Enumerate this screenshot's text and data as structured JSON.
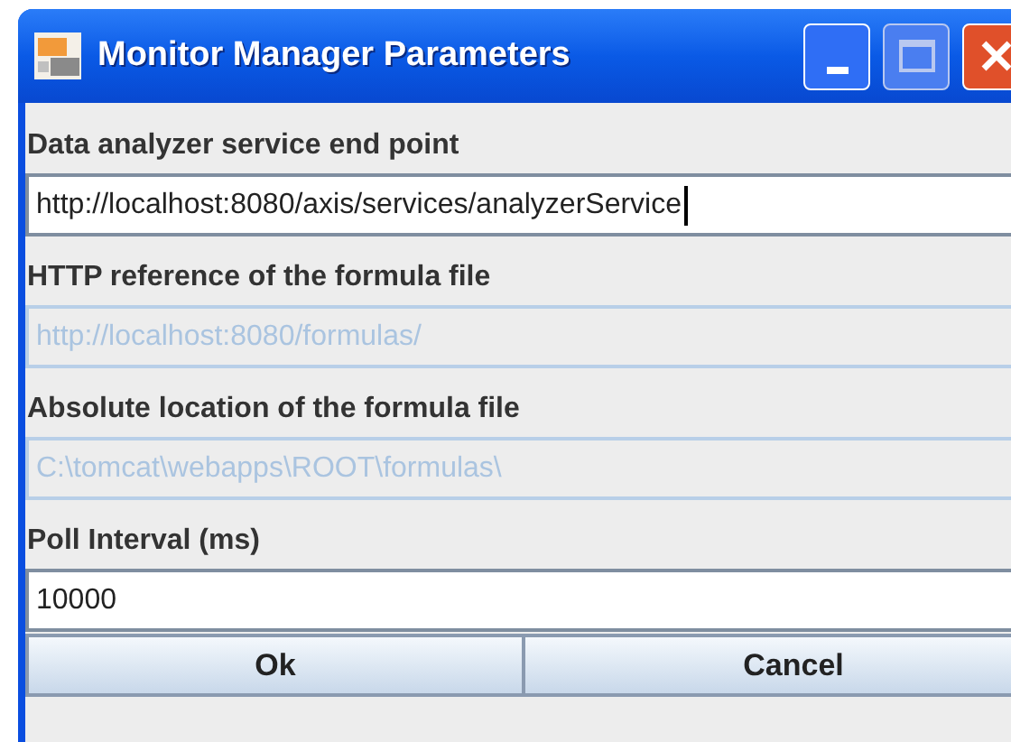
{
  "window": {
    "title": "Monitor Manager Parameters"
  },
  "fields": [
    {
      "label": "Data analyzer service end point",
      "value": "http://localhost:8080/axis/services/analyzerService",
      "disabled": false,
      "focused": true
    },
    {
      "label": "HTTP reference of the formula file",
      "value": "http://localhost:8080/formulas/",
      "disabled": true,
      "focused": false
    },
    {
      "label": "Absolute location of the formula file",
      "value": "C:\\tomcat\\webapps\\ROOT\\formulas\\",
      "disabled": true,
      "focused": false
    },
    {
      "label": "Poll Interval (ms)",
      "value": "10000",
      "disabled": false,
      "focused": false
    }
  ],
  "buttons": [
    "Ok",
    "Cancel"
  ]
}
